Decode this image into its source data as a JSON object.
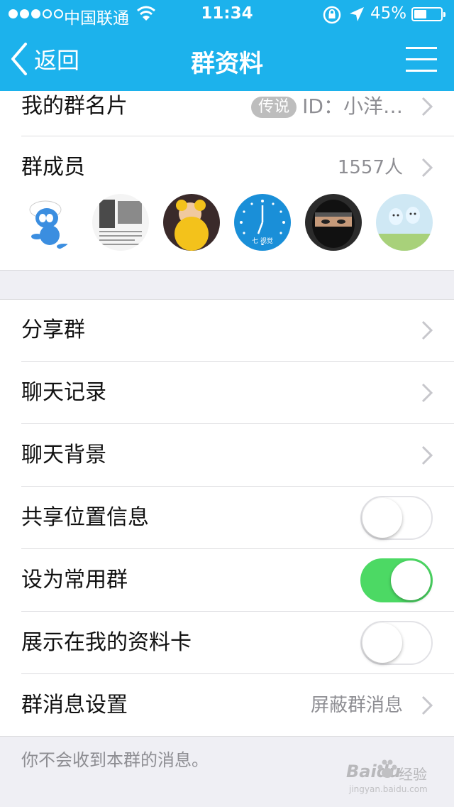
{
  "status_bar": {
    "carrier": "中国联通",
    "time": "11:34",
    "battery": "45%"
  },
  "nav": {
    "back_label": "返回",
    "title": "群资料",
    "bar_color": "#1cb2ec"
  },
  "group_card": {
    "label": "我的群名片",
    "badge": "传说",
    "value": "ID：小洋…"
  },
  "members": {
    "label": "群成员",
    "count": "1557人",
    "avatars": [
      {
        "icon": "smurf-avatar"
      },
      {
        "icon": "newspaper-avatar"
      },
      {
        "icon": "baby-avatar"
      },
      {
        "icon": "clock-avatar"
      },
      {
        "icon": "ninja-avatar"
      },
      {
        "icon": "cartoon-sky-avatar"
      }
    ]
  },
  "settings": {
    "share": "分享群",
    "history": "聊天记录",
    "background": "聊天背景",
    "share_location": {
      "label": "共享位置信息",
      "enabled": false
    },
    "frequent": {
      "label": "设为常用群",
      "enabled": true
    },
    "show_profile": {
      "label": "展示在我的资料卡",
      "enabled": false
    },
    "message": {
      "label": "群消息设置",
      "value": "屏蔽群消息"
    }
  },
  "footer": {
    "note": "你不会收到本群的消息。"
  },
  "watermark": {
    "brand": "Baidu",
    "product": "经验",
    "url": "jingyan.baidu.com"
  },
  "colors": {
    "toggle_on": "#4cd964",
    "secondary_text": "#8e8e93"
  }
}
